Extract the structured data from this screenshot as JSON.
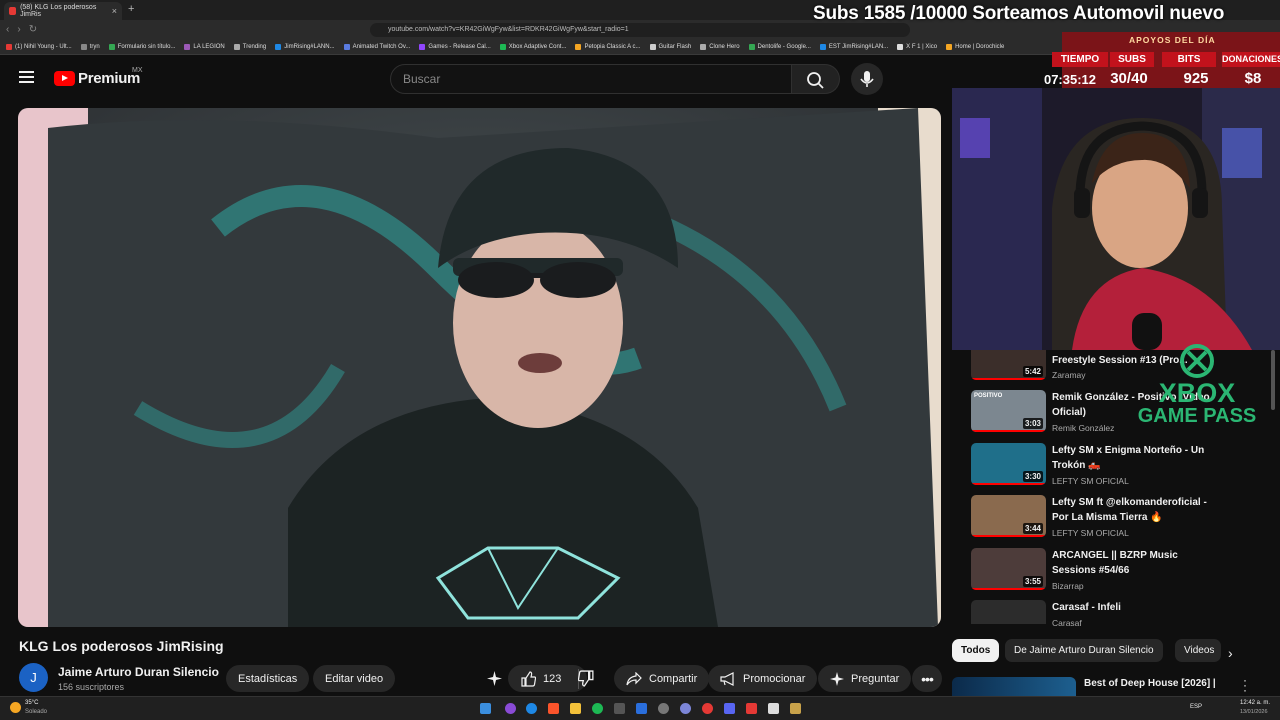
{
  "browser": {
    "tab_title": "(58) KLG Los poderosos JimRis",
    "url": "youtube.com/watch?v=KR42GiWgFyw&list=RDKR42GiWgFyw&start_radio=1",
    "bookmarks": [
      "(1) Nihil Young - Ult...",
      "tryn",
      "Formulario sin título...",
      "LA LEGION",
      "Trending",
      "JimRising#LANN...",
      "Animated Twitch Ov...",
      "Games - Release Cal...",
      "Xbox Adaptive Cont...",
      "Petopia Classic A c...",
      "Guitar Flash",
      "Clone Hero",
      "Dentolife - Google...",
      "EST JimRising#LAN...",
      "X F 1 | Xico",
      "Home | Dorochicle"
    ]
  },
  "header": {
    "logo_text": "Premium",
    "country_code": "MX",
    "search_placeholder": "Buscar"
  },
  "video": {
    "title": "KLG Los poderosos JimRising",
    "channel_initial": "J",
    "channel_name": "Jaime Arturo Duran Silencio",
    "subscribers": "156 suscriptores",
    "stats_label": "Estadísticas",
    "edit_label": "Editar video",
    "likes": "123",
    "share_label": "Compartir",
    "promote_label": "Promocionar",
    "ask_label": "Preguntar"
  },
  "sidebar": {
    "items": [
      {
        "title": "Freestyle Session #13 (Pro...",
        "channel": "Zaramay",
        "duration": "5:42"
      },
      {
        "title": "Remik González - Positivo (Video Oficial)",
        "channel": "Remik González",
        "duration": "3:03",
        "thumb_text": "POSITIVO"
      },
      {
        "title": "Lefty SM x Enigma Norteño - Un Trokón 🛻",
        "channel": "LEFTY SM OFICIAL",
        "duration": "3:30"
      },
      {
        "title": "Lefty SM ft @elkomanderoficial - Por La Misma Tierra 🔥",
        "channel": "LEFTY SM OFICIAL",
        "duration": "3:44"
      },
      {
        "title": "ARCANGEL || BZRP Music Sessions #54/66",
        "channel": "Bizarrap",
        "duration": "3:55"
      },
      {
        "title": "Carasaf - Infeli",
        "channel": "Carasaf",
        "duration": ""
      }
    ],
    "chips": [
      "Todos",
      "De Jaime Arturo Duran Silencio",
      "Videos"
    ],
    "bottom_item_title": "Best of Deep House [2026] |"
  },
  "overlay": {
    "subs_goal": "Subs 1585 /10000 Sorteamos Automovil nuevo",
    "panel_title": "APOYOS DEL DÍA",
    "headers": [
      "TIEMPO",
      "SUBS",
      "BITS",
      "DONACIONES"
    ],
    "values": [
      "07:35:12",
      "30/40",
      "925",
      "$8"
    ],
    "xbox_line1": "XBOX",
    "xbox_line2": "GAME PASS"
  },
  "taskbar": {
    "weather_temp": "35°C",
    "weather_text": "Soleado",
    "lang": "ESP",
    "time": "12:42 a. m.",
    "date": "13/01/2026"
  },
  "colors": {
    "youtube_red": "#ff0000",
    "overlay_red": "#c2121c",
    "panel_dark_red": "#7b1418",
    "xbox_green": "#2bb673"
  }
}
